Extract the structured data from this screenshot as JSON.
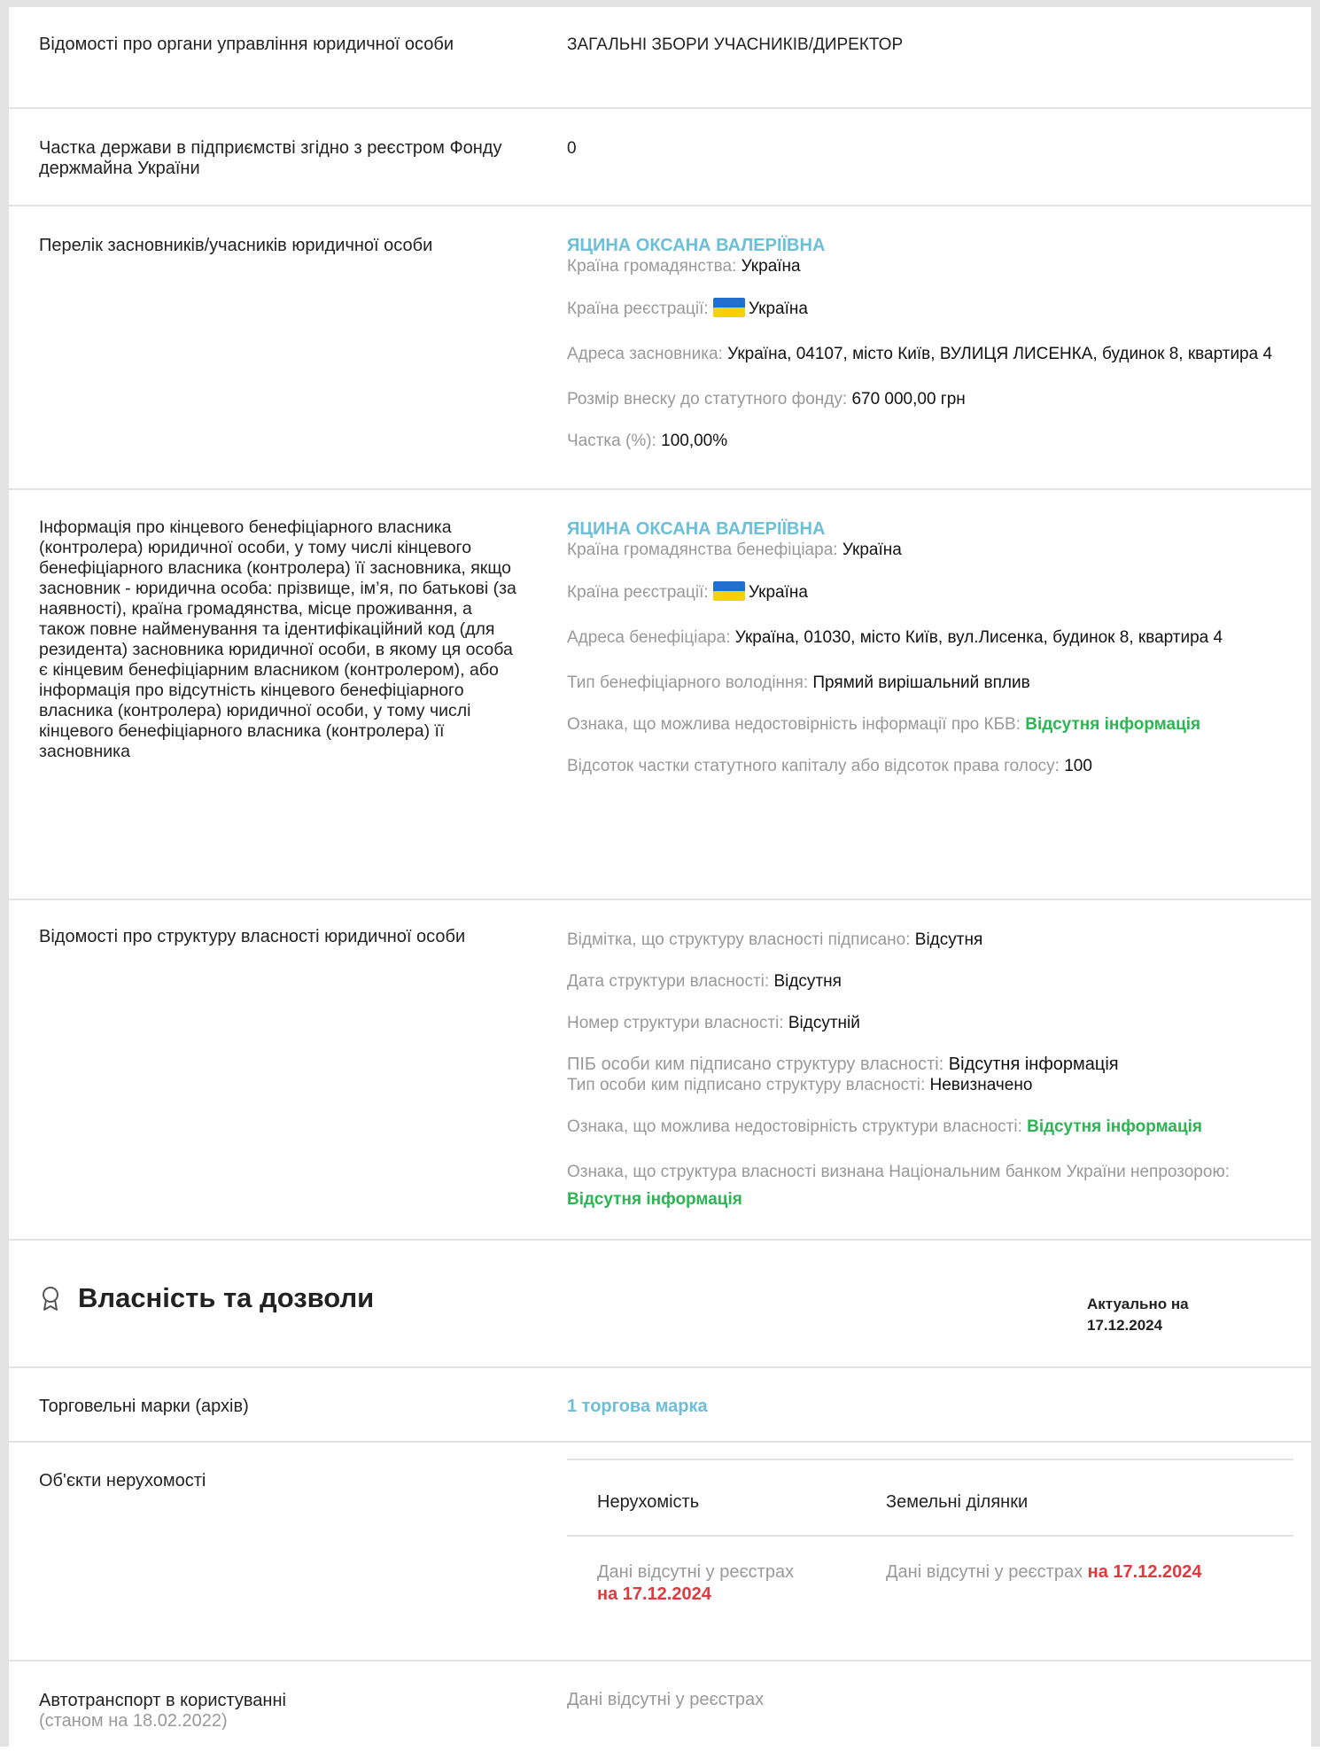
{
  "rows": {
    "management": {
      "label": "Відомості про органи управління юридичної особи",
      "value": "ЗАГАЛЬНІ ЗБОРИ УЧАСНИКІВ/ДИРЕКТОР"
    },
    "state_share": {
      "label": "Частка держави в підприємстві згідно з реєстром Фонду держмайна України",
      "value": "0"
    },
    "founders": {
      "label": "Перелік засновників/учасників юридичної особи",
      "name": "ЯЦИНА ОКСАНА ВАЛЕРІЇВНА",
      "citizenship_label": "Країна громадянства:",
      "citizenship": "Україна",
      "registration_label": "Країна реєстрації:",
      "registration": "Україна",
      "address_label": "Адреса засновника:",
      "address": "Україна, 04107, місто Київ, ВУЛИЦЯ ЛИСЕНКА, будинок 8, квартира 4",
      "contribution_label": "Розмір внеску до статутного фонду:",
      "contribution": "670 000,00 грн",
      "share_label": "Частка (%):",
      "share": "100,00%"
    },
    "beneficiary": {
      "label": "Інформація про кінцевого бенефіціарного власника (контролера) юридичної особи, у тому числі кінцевого бенефіціарного власника (контролера) її засновника, якщо засновник - юридична особа: прізвище, ім’я, по батькові (за наявності), країна громадянства, місце проживання, а також повне найменування та ідентифікаційний код (для резидента) засновника юридичної особи, в якому ця особа є кінцевим бенефіціарним власником (контролером), або інформація про відсутність кінцевого бенефіціарного власника (контролера) юридичної особи, у тому числі кінцевого бенефіціарного власника (контролера) її засновника",
      "name": "ЯЦИНА ОКСАНА ВАЛЕРІЇВНА",
      "citizenship_label": "Країна громадянства бенефіціара:",
      "citizenship": "Україна",
      "registration_label": "Країна реєстрації:",
      "registration": "Україна",
      "address_label": "Адреса бенефіціара:",
      "address": "Україна, 01030, місто Київ, вул.Лисенка, будинок 8, квартира 4",
      "type_label": "Тип бенефіціарного володіння:",
      "type": "Прямий вирішальний вплив",
      "unreliable_label": "Ознака, що можлива недостовірність інформації про КБВ:",
      "unreliable": "Відсутня інформація",
      "percent_label": "Відсоток частки статутного капіталу або відсоток права голосу:",
      "percent": "100"
    },
    "ownership": {
      "label": "Відомості про структуру власності юридичної особи",
      "signed_label": "Відмітка, що структуру власності підписано:",
      "signed": "Відсутня",
      "date_label": "Дата структури власності:",
      "date": "Відсутня",
      "number_label": "Номер структури власності:",
      "number": "Відсутній",
      "signer_label": "ПІБ особи ким підписано структуру власності:",
      "signer": "Відсутня інформація",
      "signer_type_label": "Тип особи ким підписано структуру власності:",
      "signer_type": "Невизначено",
      "unreliable_label": "Ознака, що можлива недостовірність структури власності:",
      "unreliable": "Відсутня інформація",
      "nbu_label": "Ознака, що структура власності визнана Національним банком України непрозорою:",
      "nbu": "Відсутня інформація"
    }
  },
  "property_section": {
    "title": "Власність та дозволи",
    "icon": "award-icon",
    "actual_label": "Актуально на",
    "actual_date": "17.12.2024",
    "trademarks": {
      "label": "Торговельні марки (архів)",
      "link": "1 торгова марка"
    },
    "real_estate": {
      "label": "Об'єкти нерухомості",
      "col1": "Нерухомість",
      "col2": "Земельні ділянки",
      "empty_text": "Дані відсутні у реєстрах",
      "empty_date": "на 17.12.2024"
    },
    "vehicles": {
      "label": "Автотранспорт в користуванні",
      "sub": "(станом на 18.02.2022)",
      "value": "Дані відсутні у реєстрах"
    }
  },
  "colors": {
    "link": "#6bbfd9",
    "positive": "#2db553",
    "date": "#e0393e",
    "muted": "#999999",
    "border": "#e3e3e3"
  }
}
